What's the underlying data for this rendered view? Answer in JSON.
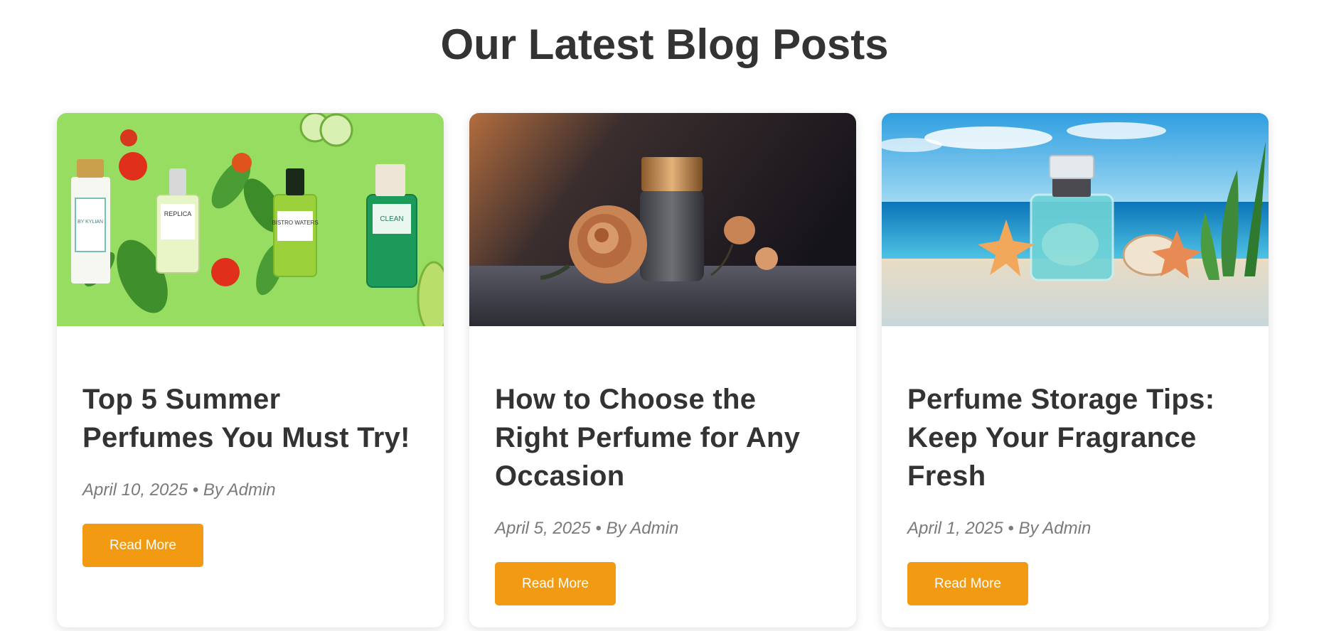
{
  "section": {
    "title": "Our Latest Blog Posts"
  },
  "posts": [
    {
      "title": "Top 5 Summer Perfumes You Must Try!",
      "date": "April 10, 2025",
      "author": "By Admin",
      "meta": "April 10, 2025 • By Admin",
      "button_label": "Read More",
      "image": {
        "bottle_labels": [
          "BY KYLIAN",
          "REPLICA",
          "BISTRO WATERS",
          "CLEAN"
        ]
      }
    },
    {
      "title": "How to Choose the Right Perfume for Any Occasion",
      "date": "April 5, 2025",
      "author": "By Admin",
      "meta": "April 5, 2025 • By Admin",
      "button_label": "Read More",
      "image": {}
    },
    {
      "title": "Perfume Storage Tips: Keep Your Fragrance Fresh",
      "date": "April 1, 2025",
      "author": "By Admin",
      "meta": "April 1, 2025 • By Admin",
      "button_label": "Read More",
      "image": {}
    }
  ],
  "colors": {
    "accent": "#f29b12",
    "title_text": "#333333",
    "meta_text": "#7a7a7a",
    "background": "#ffffff"
  }
}
